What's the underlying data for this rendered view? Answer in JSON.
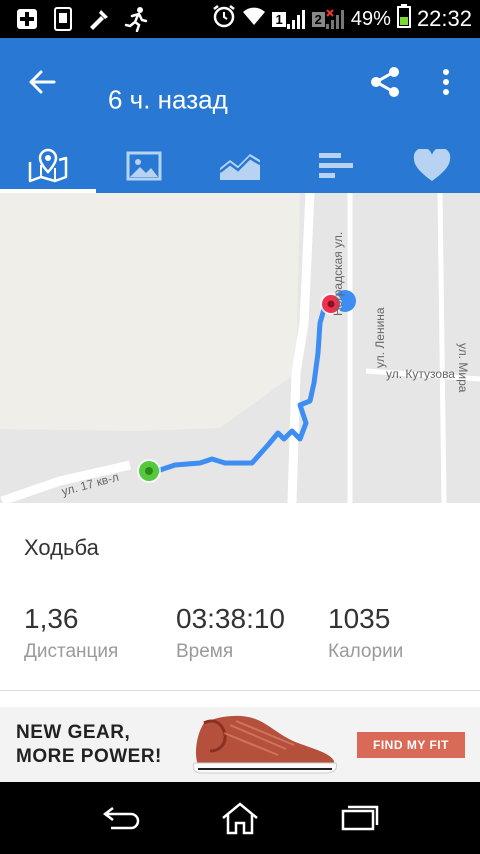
{
  "status_bar": {
    "sim1": "1",
    "sim2": "2",
    "battery": "49%",
    "time": "22:32"
  },
  "app_bar": {
    "title": "6 ч. назад"
  },
  "tabs": [
    "map",
    "photos",
    "chart",
    "splits",
    "heart-rate"
  ],
  "map": {
    "streets": {
      "lenina": "ул. Ленина",
      "mira": "ул. Мира",
      "kutuzova": "ул. Кутузова",
      "nogradskaya": "Ноградская ул.",
      "kvartal": "ул. 17 кв-л"
    }
  },
  "activity": {
    "type": "Ходьба",
    "stats": [
      {
        "value": "1,36",
        "label": "Дистанция"
      },
      {
        "value": "03:38:10",
        "label": "Время"
      },
      {
        "value": "1035",
        "label": "Калории"
      }
    ]
  },
  "ad": {
    "headline_line1": "NEW GEAR,",
    "headline_line2": "MORE POWER!",
    "cta": "FIND MY FIT"
  },
  "colors": {
    "primary": "#2979d4",
    "route": "#3d8df2",
    "start": "#55c93d",
    "end": "#f0304f"
  }
}
